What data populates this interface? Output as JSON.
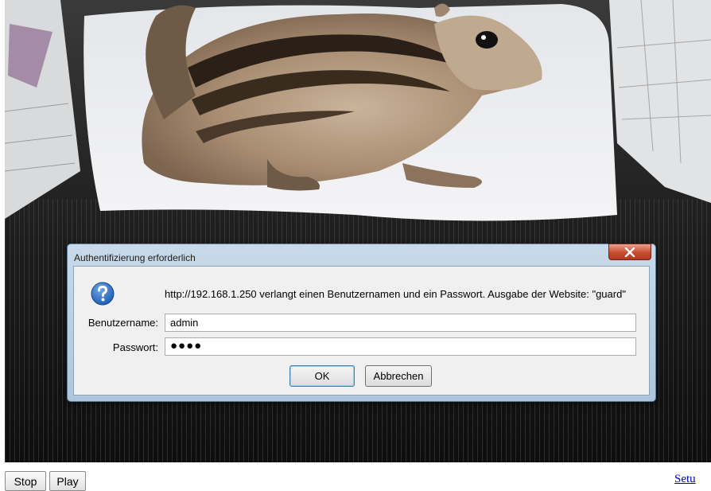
{
  "dialog": {
    "title": "Authentifizierung erforderlich",
    "message": "http://192.168.1.250 verlangt einen Benutzernamen und ein Passwort. Ausgabe der Website: \"guard\"",
    "username_label": "Benutzername:",
    "username_value": "admin",
    "password_label": "Passwort:",
    "password_value": "●●●●",
    "ok_label": "OK",
    "cancel_label": "Abbrechen",
    "close_icon": "close-x-icon",
    "help_icon": "question-mark-icon"
  },
  "controls": {
    "stop_label": "Stop",
    "play_label": "Play",
    "setup_label": "Setu"
  },
  "colors": {
    "link": "#0000cc",
    "close_button": "#c74c32",
    "help_icon": "#1f5fb5"
  }
}
